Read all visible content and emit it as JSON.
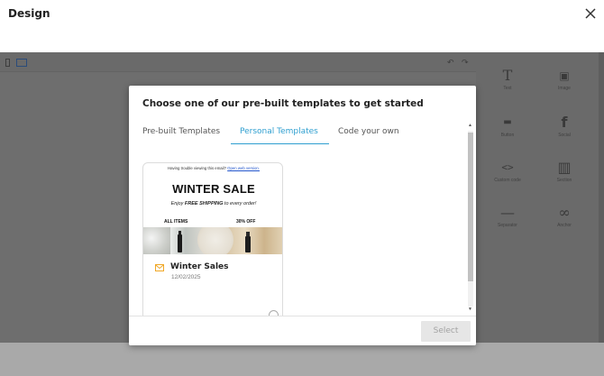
{
  "window": {
    "title": "Design"
  },
  "editor": {
    "tools": [
      {
        "label": "Text",
        "icon": "text-icon",
        "glyph": "T"
      },
      {
        "label": "Image",
        "icon": "image-icon",
        "glyph": "▣"
      },
      {
        "label": "Button",
        "icon": "button-icon",
        "glyph": "▬"
      },
      {
        "label": "Social",
        "icon": "facebook-icon",
        "glyph": "f"
      },
      {
        "label": "Custom code",
        "icon": "code-icon",
        "glyph": "<>"
      },
      {
        "label": "Section",
        "icon": "section-icon",
        "glyph": "▥"
      },
      {
        "label": "Separator",
        "icon": "separator-icon",
        "glyph": "—"
      },
      {
        "label": "Anchor",
        "icon": "link-icon",
        "glyph": "∞"
      }
    ]
  },
  "modal": {
    "heading": "Choose one of our pre-built templates to get started",
    "tabs": [
      {
        "label": "Pre-built Templates",
        "active": false
      },
      {
        "label": "Personal Templates",
        "active": true
      },
      {
        "label": "Code your own",
        "active": false
      }
    ],
    "templates": [
      {
        "name": "Winter Sales",
        "date": "12/02/2025",
        "preview": {
          "trouble_text": "Having trouble viewing this email?",
          "trouble_link": "Open web version.",
          "headline": "WINTER SALE",
          "sub_prefix": "Enjoy ",
          "sub_bold": "FREE SHIPPING",
          "sub_suffix": " to every order!",
          "left_label": "ALL ITEMS",
          "right_label": "30% OFF"
        }
      }
    ],
    "select_label": "Select"
  },
  "colors": {
    "accent": "#2f9fd0",
    "mail_icon": "#f0a828"
  }
}
